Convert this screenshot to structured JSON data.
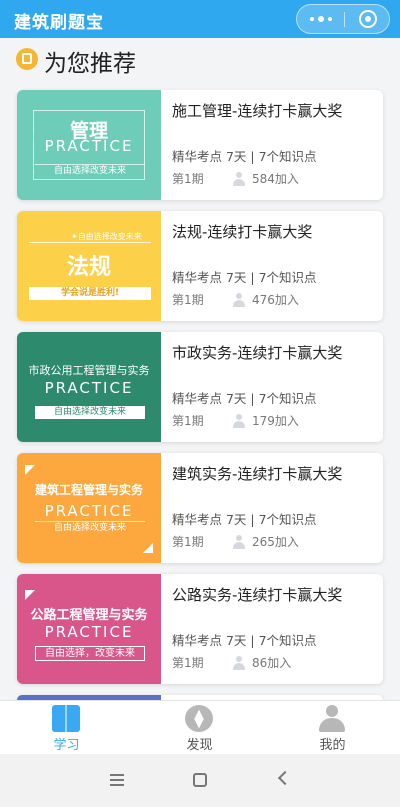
{
  "header": {
    "title": "建筑刷题宝"
  },
  "section": {
    "title": "为您推荐"
  },
  "cards": [
    {
      "thumb_big": "管理",
      "thumb_en": "PRACTICE",
      "thumb_tag": "自由选择改变未来",
      "title": "施工管理-连续打卡赢大奖",
      "points": "精华考点  7天 | 7个知识点",
      "issue": "第1期",
      "joined": "584加入",
      "color": "#6ecdb8"
    },
    {
      "thumb_small_top": "✦自由选择改变未来",
      "thumb_big": "法规",
      "thumb_tag": "学会说是胜利!",
      "title": "法规-连续打卡赢大奖",
      "points": "精华考点  7天 | 7个知识点",
      "issue": "第1期",
      "joined": "476加入",
      "color": "#fdd04a"
    },
    {
      "thumb_big": "市政公用工程管理与实务",
      "thumb_en": "PRACTICE",
      "thumb_tag": "自由选择改变未来",
      "title": "市政实务-连续打卡赢大奖",
      "points": "精华考点  7天 | 7个知识点",
      "issue": "第1期",
      "joined": "179加入",
      "color": "#2e8a6c"
    },
    {
      "thumb_big": "建筑工程管理与实务",
      "thumb_en": "PRACTICE",
      "thumb_tag": "自由选择改变未来",
      "title": "建筑实务-连续打卡赢大奖",
      "points": "精华考点  7天 | 7个知识点",
      "issue": "第1期",
      "joined": "265加入",
      "color": "#fca83f"
    },
    {
      "thumb_big": "公路工程管理与实务",
      "thumb_en": "PRACTICE",
      "thumb_tag": "自由选择，改变未来",
      "title": "公路实务-连续打卡赢大奖",
      "points": "精华考点  7天 | 7个知识点",
      "issue": "第1期",
      "joined": "86加入",
      "color": "#d9568a"
    }
  ],
  "tabbar": {
    "tabs": [
      {
        "label": "学习",
        "icon": "book-icon",
        "active": true
      },
      {
        "label": "发现",
        "icon": "compass-icon",
        "active": false
      },
      {
        "label": "我的",
        "icon": "user-icon",
        "active": false
      }
    ],
    "active_color": "#3aa9f3",
    "inactive_color": "#555555"
  }
}
